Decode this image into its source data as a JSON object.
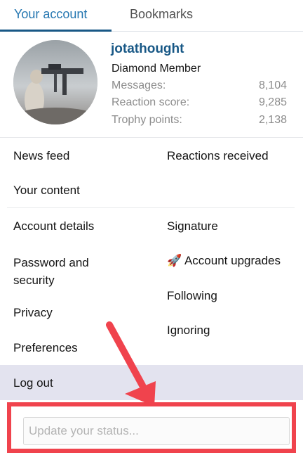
{
  "tabs": {
    "your_account": "Your account",
    "bookmarks": "Bookmarks"
  },
  "profile": {
    "username": "jotathought",
    "title": "Diamond Member",
    "stats": [
      {
        "label": "Messages:",
        "value": "8,104"
      },
      {
        "label": "Reaction score:",
        "value": "9,285"
      },
      {
        "label": "Trophy points:",
        "value": "2,138"
      }
    ]
  },
  "menu": {
    "news_feed": "News feed",
    "reactions_received": "Reactions received",
    "your_content": "Your content",
    "account_details": "Account details",
    "signature": "Signature",
    "password_security_line1": "Password and",
    "password_security_line2": "security",
    "account_upgrades_icon": "🚀",
    "account_upgrades": "Account upgrades",
    "following": "Following",
    "privacy": "Privacy",
    "ignoring": "Ignoring",
    "preferences": "Preferences",
    "log_out": "Log out"
  },
  "status": {
    "placeholder": "Update your status..."
  },
  "colors": {
    "link_blue": "#185886",
    "annotation_red": "#f0434d",
    "logout_bg": "#e3e3ef"
  }
}
